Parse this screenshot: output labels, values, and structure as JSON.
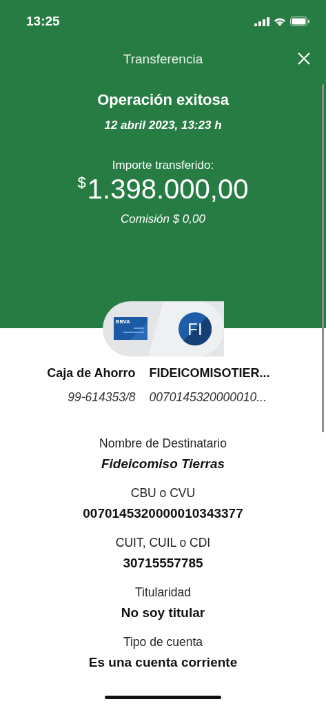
{
  "status_bar": {
    "time": "13:25"
  },
  "header": {
    "title": "Transferencia"
  },
  "result": {
    "title": "Operación exitosa",
    "date": "12 abril 2023, 13:23 h",
    "amount_label": "Importe transferido:",
    "currency": "$",
    "amount": "1.398.000,00",
    "fee": "Comisión  $ 0,00"
  },
  "accounts": {
    "card_brand": "BBVA",
    "initials": "FI",
    "origin": {
      "name": "Caja de Ahorro",
      "number": "99-614353/8"
    },
    "destination": {
      "name": "FIDEICOMISOTIER...",
      "number": "0070145320000010..."
    }
  },
  "details": [
    {
      "label": "Nombre de Destinatario",
      "value": "Fideicomiso Tierras",
      "kind": "name"
    },
    {
      "label": "CBU o CVU",
      "value": "0070145320000010343377",
      "kind": "text"
    },
    {
      "label": "CUIT, CUIL o CDI",
      "value": "30715557785",
      "kind": "text"
    },
    {
      "label": "Titularidad",
      "value": "No soy titular",
      "kind": "text"
    },
    {
      "label": "Tipo de cuenta",
      "value": "Es una cuenta corriente",
      "kind": "text"
    }
  ]
}
